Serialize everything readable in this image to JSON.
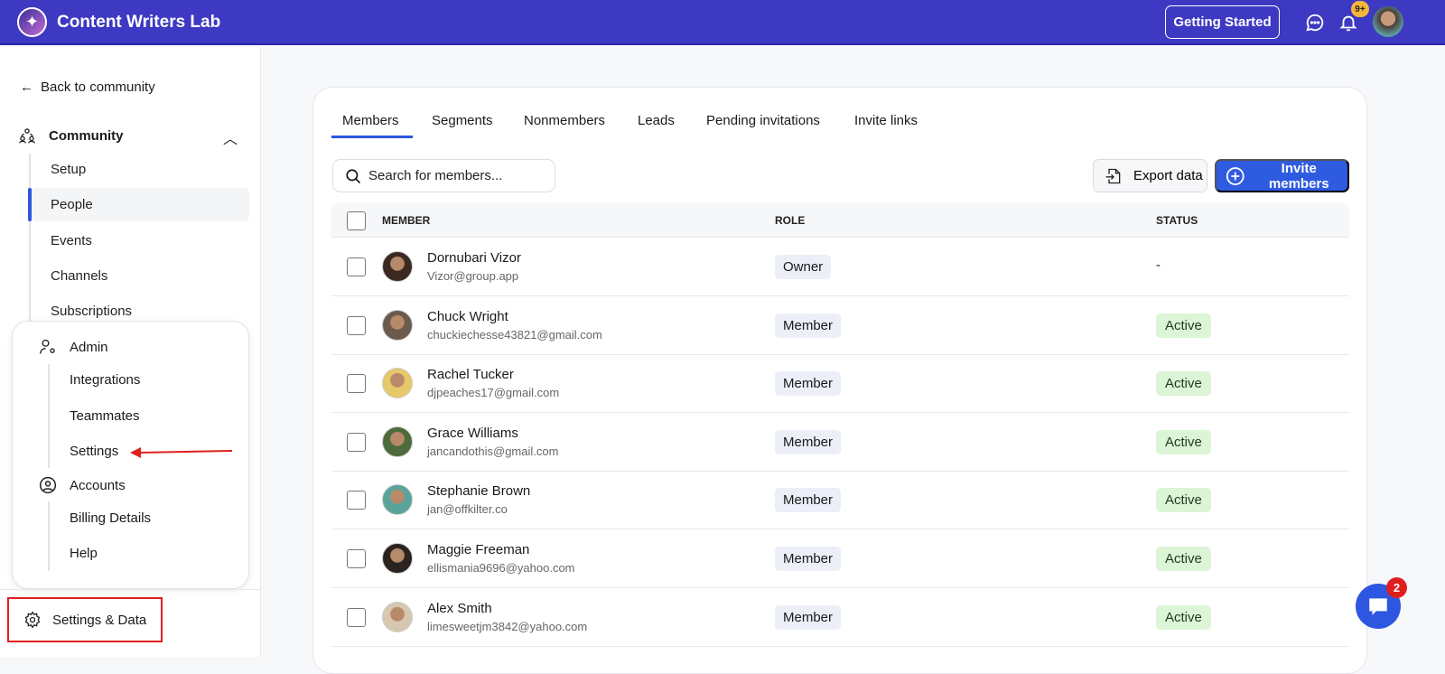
{
  "header": {
    "app_title": "Content Writers Lab",
    "getting_started": "Getting Started",
    "notifications_badge": "9+"
  },
  "sidebar": {
    "back": "Back to community",
    "community": {
      "label": "Community",
      "items": [
        {
          "label": "Setup"
        },
        {
          "label": "People"
        },
        {
          "label": "Events"
        },
        {
          "label": "Channels"
        },
        {
          "label": "Subscriptions"
        }
      ]
    },
    "admin": {
      "label": "Admin",
      "items": [
        {
          "label": "Integrations"
        },
        {
          "label": "Teammates"
        },
        {
          "label": "Settings"
        }
      ]
    },
    "accounts": {
      "label": "Accounts",
      "items": [
        {
          "label": "Billing Details"
        },
        {
          "label": "Help"
        }
      ]
    },
    "settings_data": "Settings & Data"
  },
  "main": {
    "tabs": [
      {
        "label": "Members"
      },
      {
        "label": "Segments"
      },
      {
        "label": "Nonmembers"
      },
      {
        "label": "Leads"
      },
      {
        "label": "Pending invitations"
      },
      {
        "label": "Invite links"
      }
    ],
    "search_placeholder": "Search for members...",
    "export": "Export data",
    "invite": "Invite members",
    "columns": {
      "member": "MEMBER",
      "role": "ROLE",
      "status": "STATUS"
    },
    "rows": [
      {
        "name": "Dornubari Vizor",
        "email": "Vizor@group.app",
        "role": "Owner",
        "status": "-"
      },
      {
        "name": "Chuck Wright",
        "email": "chuckiechesse43821@gmail.com",
        "role": "Member",
        "status": "Active"
      },
      {
        "name": "Rachel Tucker",
        "email": "djpeaches17@gmail.com",
        "role": "Member",
        "status": "Active"
      },
      {
        "name": "Grace Williams",
        "email": "jancandothis@gmail.com",
        "role": "Member",
        "status": "Active"
      },
      {
        "name": "Stephanie Brown",
        "email": "jan@offkilter.co",
        "role": "Member",
        "status": "Active"
      },
      {
        "name": "Maggie Freeman",
        "email": "ellismania9696@yahoo.com",
        "role": "Member",
        "status": "Active"
      },
      {
        "name": "Alex Smith",
        "email": "limesweetjm3842@yahoo.com",
        "role": "Member",
        "status": "Active"
      }
    ]
  },
  "chat_badge": "2"
}
